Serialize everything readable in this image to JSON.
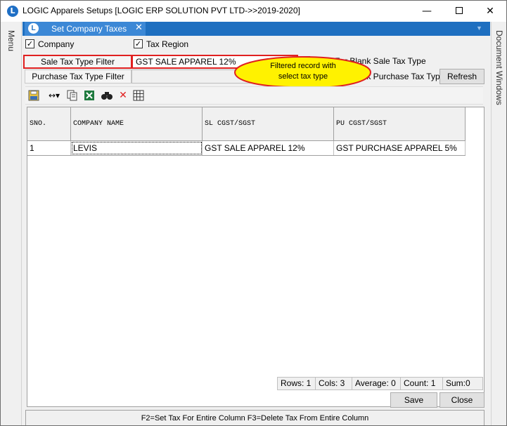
{
  "window": {
    "title": "LOGIC Apparels Setups  [LOGIC ERP SOLUTION PVT LTD->>2019-2020]",
    "app_icon": "logic-logo-icon",
    "controls": [
      "minimize-icon",
      "maximize-icon",
      "close-icon"
    ]
  },
  "side_panels": {
    "left_label": "Menu",
    "right_label": "Document Windows"
  },
  "tab": {
    "label": "Set Company Taxes",
    "close": "✕",
    "logo": "L"
  },
  "options": {
    "company": {
      "label": "Company",
      "checked": true
    },
    "tax_region": {
      "label": "Tax Region",
      "checked": true
    },
    "filter_blank_sale": {
      "label": "Filter For Blank Sale Tax Type",
      "checked": false
    },
    "filter_blank_purchase": {
      "label": "Filter For Blank Purchase Tax Type",
      "checked": false
    }
  },
  "filters": {
    "sale_label": "Sale Tax Type Filter",
    "sale_value": "GST SALE APPAREL 12%",
    "purchase_label": "Purchase Tax Type Filter",
    "purchase_value": ""
  },
  "buttons": {
    "refresh": "Refresh",
    "save": "Save",
    "close": "Close"
  },
  "callout": {
    "line1": "Filtered  record  with",
    "line2": "select  tax  type",
    "fill_color": "#fff200",
    "border_color": "#e02020"
  },
  "toolbar_icons": [
    "save-layout-icon",
    "column-width-icon",
    "copy-icon",
    "excel-export-icon",
    "find-icon",
    "delete-icon",
    "grid-icon"
  ],
  "grid": {
    "columns": [
      "SNO.",
      "COMPANY NAME",
      "SL CGST/SGST",
      "PU CGST/SGST"
    ],
    "rows": [
      [
        "1",
        "LEVIS",
        "GST SALE APPAREL 12%",
        "GST PURCHASE APPAREL 5%"
      ]
    ]
  },
  "status": {
    "rows": "Rows: 1",
    "cols": "Cols: 3",
    "average": "Average: 0",
    "count": "Count: 1",
    "sum": "Sum:0"
  },
  "footer_hint": "F2=Set Tax For Entire Column  F3=Delete Tax From Entire Column",
  "colors": {
    "tab_bar": "#1e6fc0",
    "tab_active": "#3c88d6",
    "highlight_border": "#e02020"
  }
}
